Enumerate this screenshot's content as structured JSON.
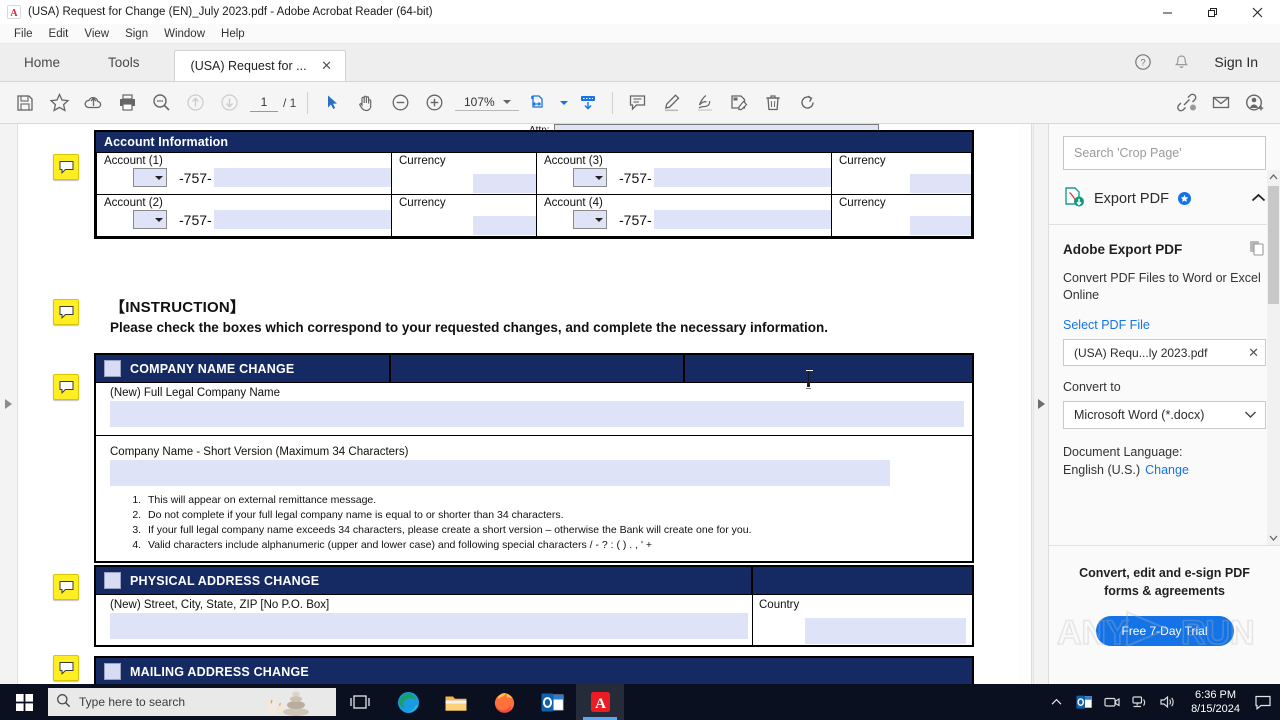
{
  "window": {
    "title": "(USA) Request for Change (EN)_July 2023.pdf - Adobe Acrobat Reader (64-bit)",
    "app_icon": "adobe-acrobat-icon",
    "controls": {
      "minimize": "minimize-icon",
      "restore": "restore-icon",
      "close": "close-icon"
    }
  },
  "menubar": {
    "items": [
      "File",
      "Edit",
      "View",
      "Sign",
      "Window",
      "Help"
    ]
  },
  "tabstrip": {
    "home": "Home",
    "tools": "Tools",
    "document_tab": "(USA) Request for ...",
    "close_glyph": "✕",
    "help_icon": "help-icon",
    "bell_icon": "notification-bell-icon",
    "signin": "Sign In"
  },
  "toolbar": {
    "save_icon": "save-icon",
    "star_icon": "add-to-favorites-icon",
    "upload_icon": "upload-to-cloud-icon",
    "print_icon": "print-icon",
    "zoom_tool_icon": "zoom-tool-icon",
    "prev_page_icon": "previous-page-icon",
    "next_page_icon": "next-page-icon",
    "page_current": "1",
    "page_total": "/ 1",
    "select_icon": "select-cursor-icon",
    "hand_icon": "hand-tool-icon",
    "zoom_out_icon": "zoom-out-icon",
    "zoom_in_icon": "zoom-in-icon",
    "zoom_value": "107%",
    "fit_icon": "fit-page-icon",
    "scroll_mode_icon": "page-display-icon",
    "comment_icon": "add-comment-icon",
    "highlight_icon": "highlight-text-icon",
    "sign_icon": "sign-document-icon",
    "fillsign_icon": "fill-and-sign-icon",
    "delete_icon": "delete-icon",
    "rotate_icon": "rotate-page-icon",
    "link_icon": "share-link-icon",
    "email_icon": "email-icon",
    "share_user_icon": "share-with-people-icon"
  },
  "document": {
    "attn_label": "Attn:",
    "account_section": {
      "header": "Account Information",
      "rows": [
        {
          "label": "Account (1)",
          "number": "-757-",
          "currency_label": "Currency"
        },
        {
          "label": "Account (3)",
          "number": "-757-",
          "currency_label": "Currency"
        },
        {
          "label": "Account (2)",
          "number": "-757-",
          "currency_label": "Currency"
        },
        {
          "label": "Account (4)",
          "number": "-757-",
          "currency_label": "Currency"
        }
      ]
    },
    "instruction": {
      "title": "【INSTRUCTION】",
      "text": "Please check the boxes which correspond to your requested changes, and complete the necessary information."
    },
    "sections": [
      {
        "title": "COMPANY NAME CHANGE",
        "field1_label": "(New) Full Legal Company Name",
        "field2_label": "Company Name - Short Version (Maximum 34 Characters)",
        "notes": [
          "This will appear on external remittance message.",
          "Do not complete if your full legal company name is equal to or shorter than 34 characters.",
          "If your full legal company name exceeds 34 characters, please create a short version – otherwise the Bank will create one for you.",
          "Valid characters include alphanumeric (upper and lower case) and following special characters / - ? : ( ) . , ' +"
        ]
      },
      {
        "title": "PHYSICAL ADDRESS CHANGE",
        "field1_label": "(New) Street, City, State, ZIP [No P.O. Box]",
        "country_label": "Country"
      },
      {
        "title": "MAILING ADDRESS CHANGE"
      }
    ],
    "note_icon": "sticky-note-comment-icon"
  },
  "right_panel": {
    "search_placeholder": "Search 'Crop Page'",
    "tool_name": "Export PDF",
    "tool_icon": "export-pdf-icon",
    "premium_badge": "premium-star-badge",
    "collapse_icon": "chevron-up-icon",
    "heading": "Adobe Export PDF",
    "copy_icon": "copy-files-icon",
    "description": "Convert PDF Files to Word or Excel Online",
    "select_file_link": "Select PDF File",
    "selected_file": "(USA) Requ...ly 2023.pdf",
    "remove_file_glyph": "✕",
    "convert_to_label": "Convert to",
    "convert_to_value": "Microsoft Word (*.docx)",
    "language_label": "Document Language:",
    "language_value": "English (U.S.)",
    "language_change": "Change",
    "promo_text": "Convert, edit and e-sign PDF forms & agreements",
    "trial_button": "Free 7-Day Trial"
  },
  "watermark": {
    "text": "ANY RUN"
  },
  "taskbar": {
    "start_icon": "windows-start-icon",
    "search_icon": "search-icon",
    "search_placeholder": "Type here to search",
    "taskview_icon": "task-view-icon",
    "apps": [
      "microsoft-edge-icon",
      "file-explorer-icon",
      "firefox-icon",
      "outlook-icon",
      "adobe-acrobat-icon"
    ],
    "tray": {
      "expand_icon": "show-hidden-icons-icon",
      "outlook_icon": "outlook-tray-icon",
      "camera_icon": "camera-tray-icon",
      "network_icon": "network-icon",
      "volume_icon": "volume-icon",
      "time": "6:36 PM",
      "date": "8/15/2024",
      "action_center_icon": "action-center-icon"
    }
  }
}
